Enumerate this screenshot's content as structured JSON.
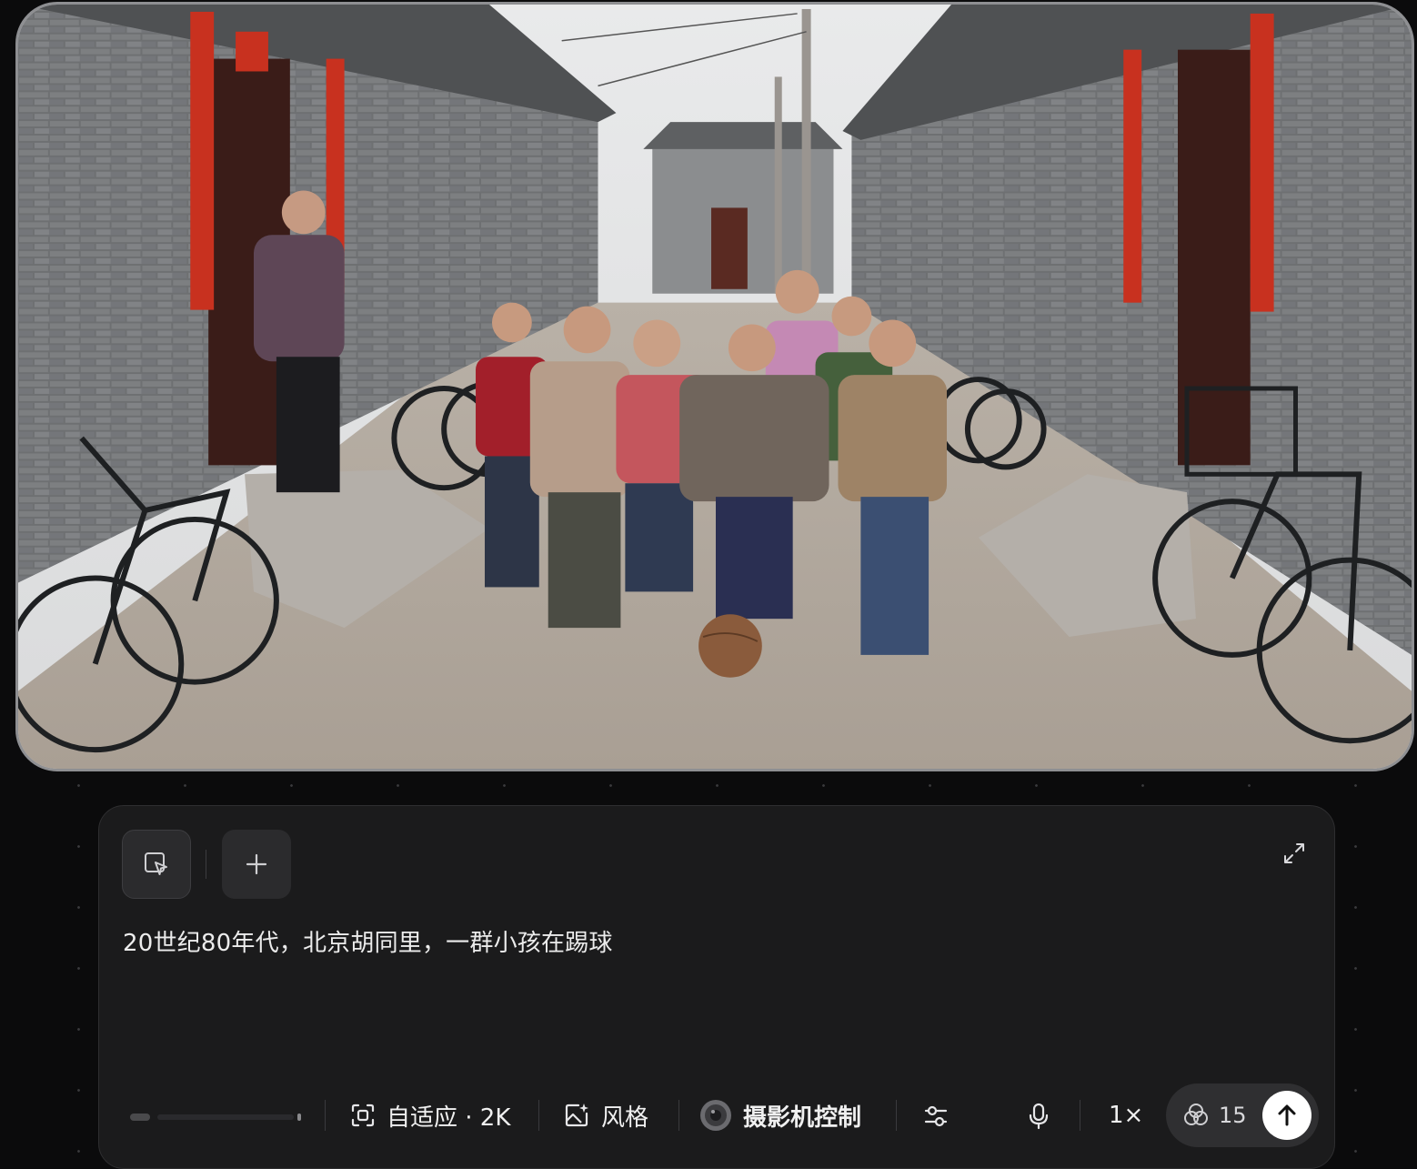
{
  "image": {
    "alt": "20世纪80年代，北京胡同里，一群小孩在踢球"
  },
  "toolbar": {
    "select_icon": "cursor-select-icon",
    "add_icon": "plus-icon",
    "expand_icon": "expand-icon"
  },
  "prompt": {
    "text": "20世纪80年代，北京胡同里，一群小孩在踢球"
  },
  "bottom_bar": {
    "aspect": {
      "icon": "frame-icon",
      "label": "自适应 · 2K"
    },
    "style": {
      "icon": "sparkle-image-icon",
      "label": "风格"
    },
    "camera": {
      "icon": "lens-icon",
      "label": "摄影机控制"
    },
    "settings_icon": "sliders-icon",
    "mic_icon": "microphone-icon",
    "count_label": "1×",
    "credits": {
      "icon": "credits-icon",
      "value": "15"
    },
    "send_icon": "arrow-up-icon"
  },
  "colors": {
    "panel_bg": "#1b1b1c",
    "button_bg": "#2b2b2d",
    "send_bg": "#ffffff",
    "couplet_red": "#c8311f"
  }
}
